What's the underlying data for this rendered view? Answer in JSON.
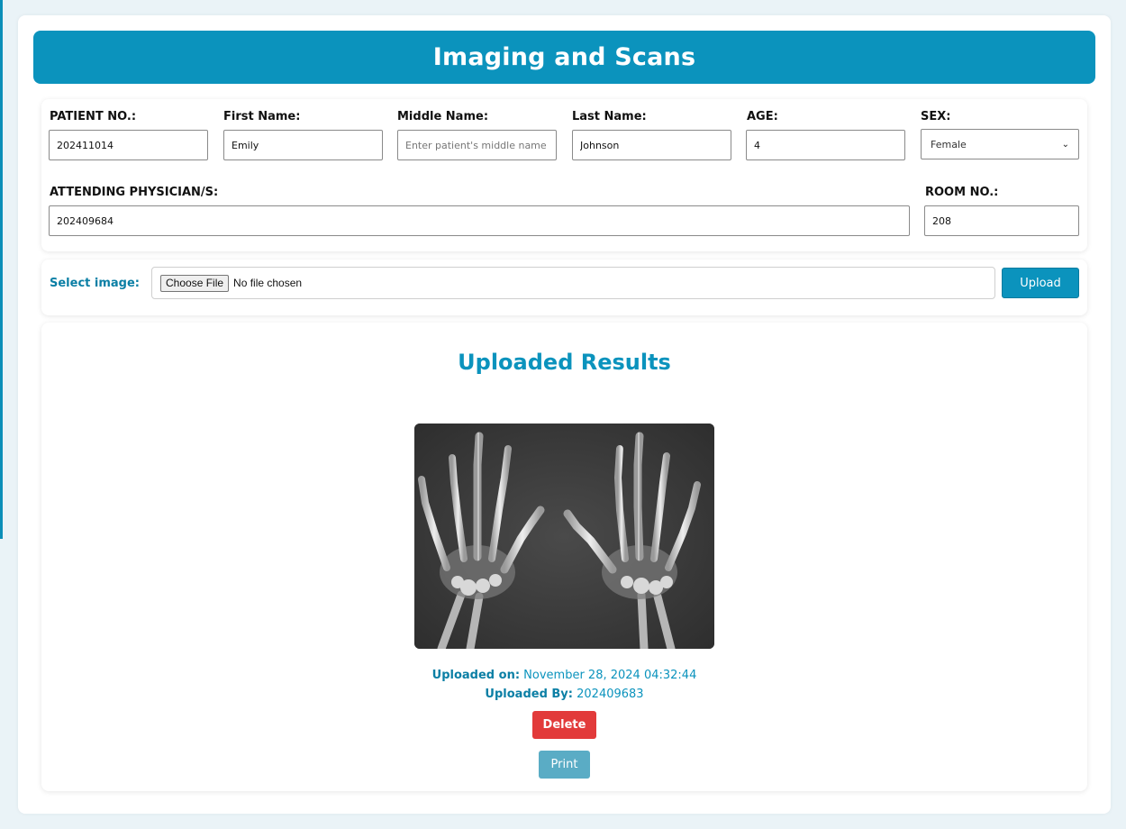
{
  "header": {
    "title": "Imaging and Scans"
  },
  "patient": {
    "patient_no_label": "PATIENT NO.:",
    "patient_no": "202411014",
    "first_name_label": "First Name:",
    "first_name": "Emily",
    "middle_name_label": "Middle Name:",
    "middle_name": "",
    "middle_name_placeholder": "Enter patient's middle name",
    "last_name_label": "Last Name:",
    "last_name": "Johnson",
    "age_label": "AGE:",
    "age": "4",
    "sex_label": "SEX:",
    "sex": "Female",
    "physician_label": "ATTENDING PHYSICIAN/S:",
    "physician": "202409684",
    "room_label": "ROOM NO.:",
    "room": "208"
  },
  "upload": {
    "select_label": "Select image:",
    "choose_file": "Choose File",
    "no_file": "No file chosen",
    "upload_button": "Upload"
  },
  "results": {
    "title": "Uploaded Results",
    "uploaded_on_label": "Uploaded on:",
    "uploaded_on": "November 28, 2024 04:32:44",
    "uploaded_by_label": "Uploaded By:",
    "uploaded_by": "202409683",
    "delete_button": "Delete",
    "print_button": "Print"
  },
  "colors": {
    "accent": "#0b93bd",
    "danger": "#e23a3a",
    "print": "#5aacc5"
  }
}
